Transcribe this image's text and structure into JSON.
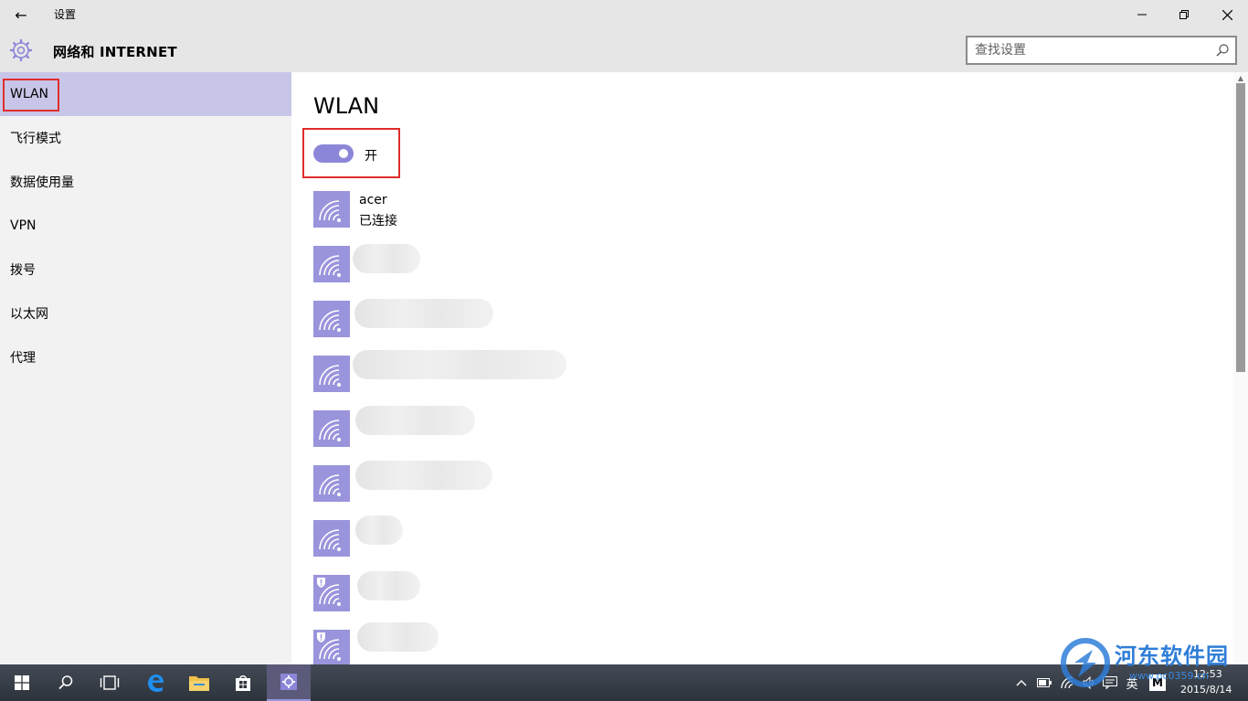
{
  "window": {
    "title": "设置",
    "back_glyph": "←"
  },
  "header": {
    "heading": "网络和 INTERNET",
    "search_placeholder": "查找设置"
  },
  "sidebar": {
    "items": [
      {
        "label": "WLAN",
        "active": true
      },
      {
        "label": "飞行模式",
        "active": false
      },
      {
        "label": "数据使用量",
        "active": false
      },
      {
        "label": "VPN",
        "active": false
      },
      {
        "label": "拨号",
        "active": false
      },
      {
        "label": "以太网",
        "active": false
      },
      {
        "label": "代理",
        "active": false
      }
    ]
  },
  "main": {
    "title": "WLAN",
    "toggle": {
      "state": "on",
      "label": "开"
    },
    "networks": [
      {
        "name": "acer",
        "status": "已连接",
        "secured": false
      },
      {
        "name": "",
        "secured": false
      },
      {
        "name": "",
        "secured": false
      },
      {
        "name": "",
        "secured": false
      },
      {
        "name": "",
        "secured": false
      },
      {
        "name": "",
        "secured": false
      },
      {
        "name": "",
        "secured": false
      },
      {
        "name": "",
        "secured": true
      },
      {
        "name": "",
        "secured": true
      }
    ]
  },
  "taskbar": {
    "language": "英",
    "ime": "M",
    "time": "12:53",
    "date": "2015/8/14"
  },
  "watermark": {
    "text": "河东软件园",
    "sub": "www.pc0359.cn"
  },
  "colors": {
    "accent": "#9a94dc",
    "selection": "#c8c6e8",
    "highlight_box": "#e02c2c",
    "chrome": "#e6e6e6"
  }
}
